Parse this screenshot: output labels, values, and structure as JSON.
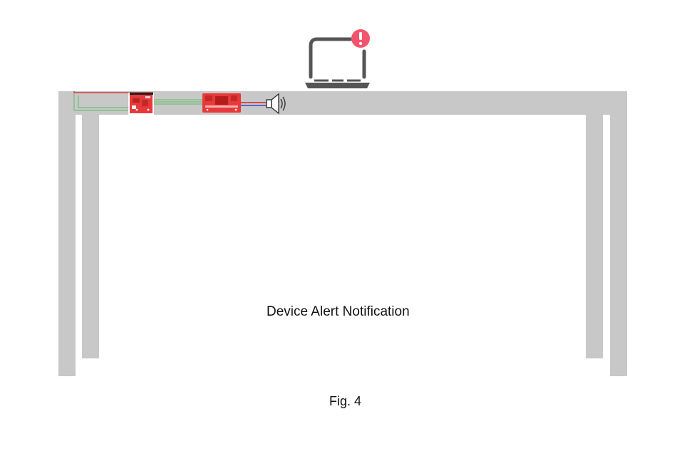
{
  "figure": {
    "caption": "Device Alert Notification",
    "fig_label": "Fig. 4"
  },
  "colors": {
    "table": "#c8c8c8",
    "board": "#e8393a",
    "alert": "#f2556b",
    "laptop": "#555555",
    "wire_green": "#6fbf73",
    "wire_red": "#e02020",
    "wire_blue": "#2a4bd7",
    "speaker": "#333333"
  },
  "icons": {
    "laptop": "laptop-icon",
    "alert": "alert-icon",
    "speaker": "speaker-icon",
    "microcontroller": "microcontroller-board",
    "amplifier": "amplifier-board"
  }
}
